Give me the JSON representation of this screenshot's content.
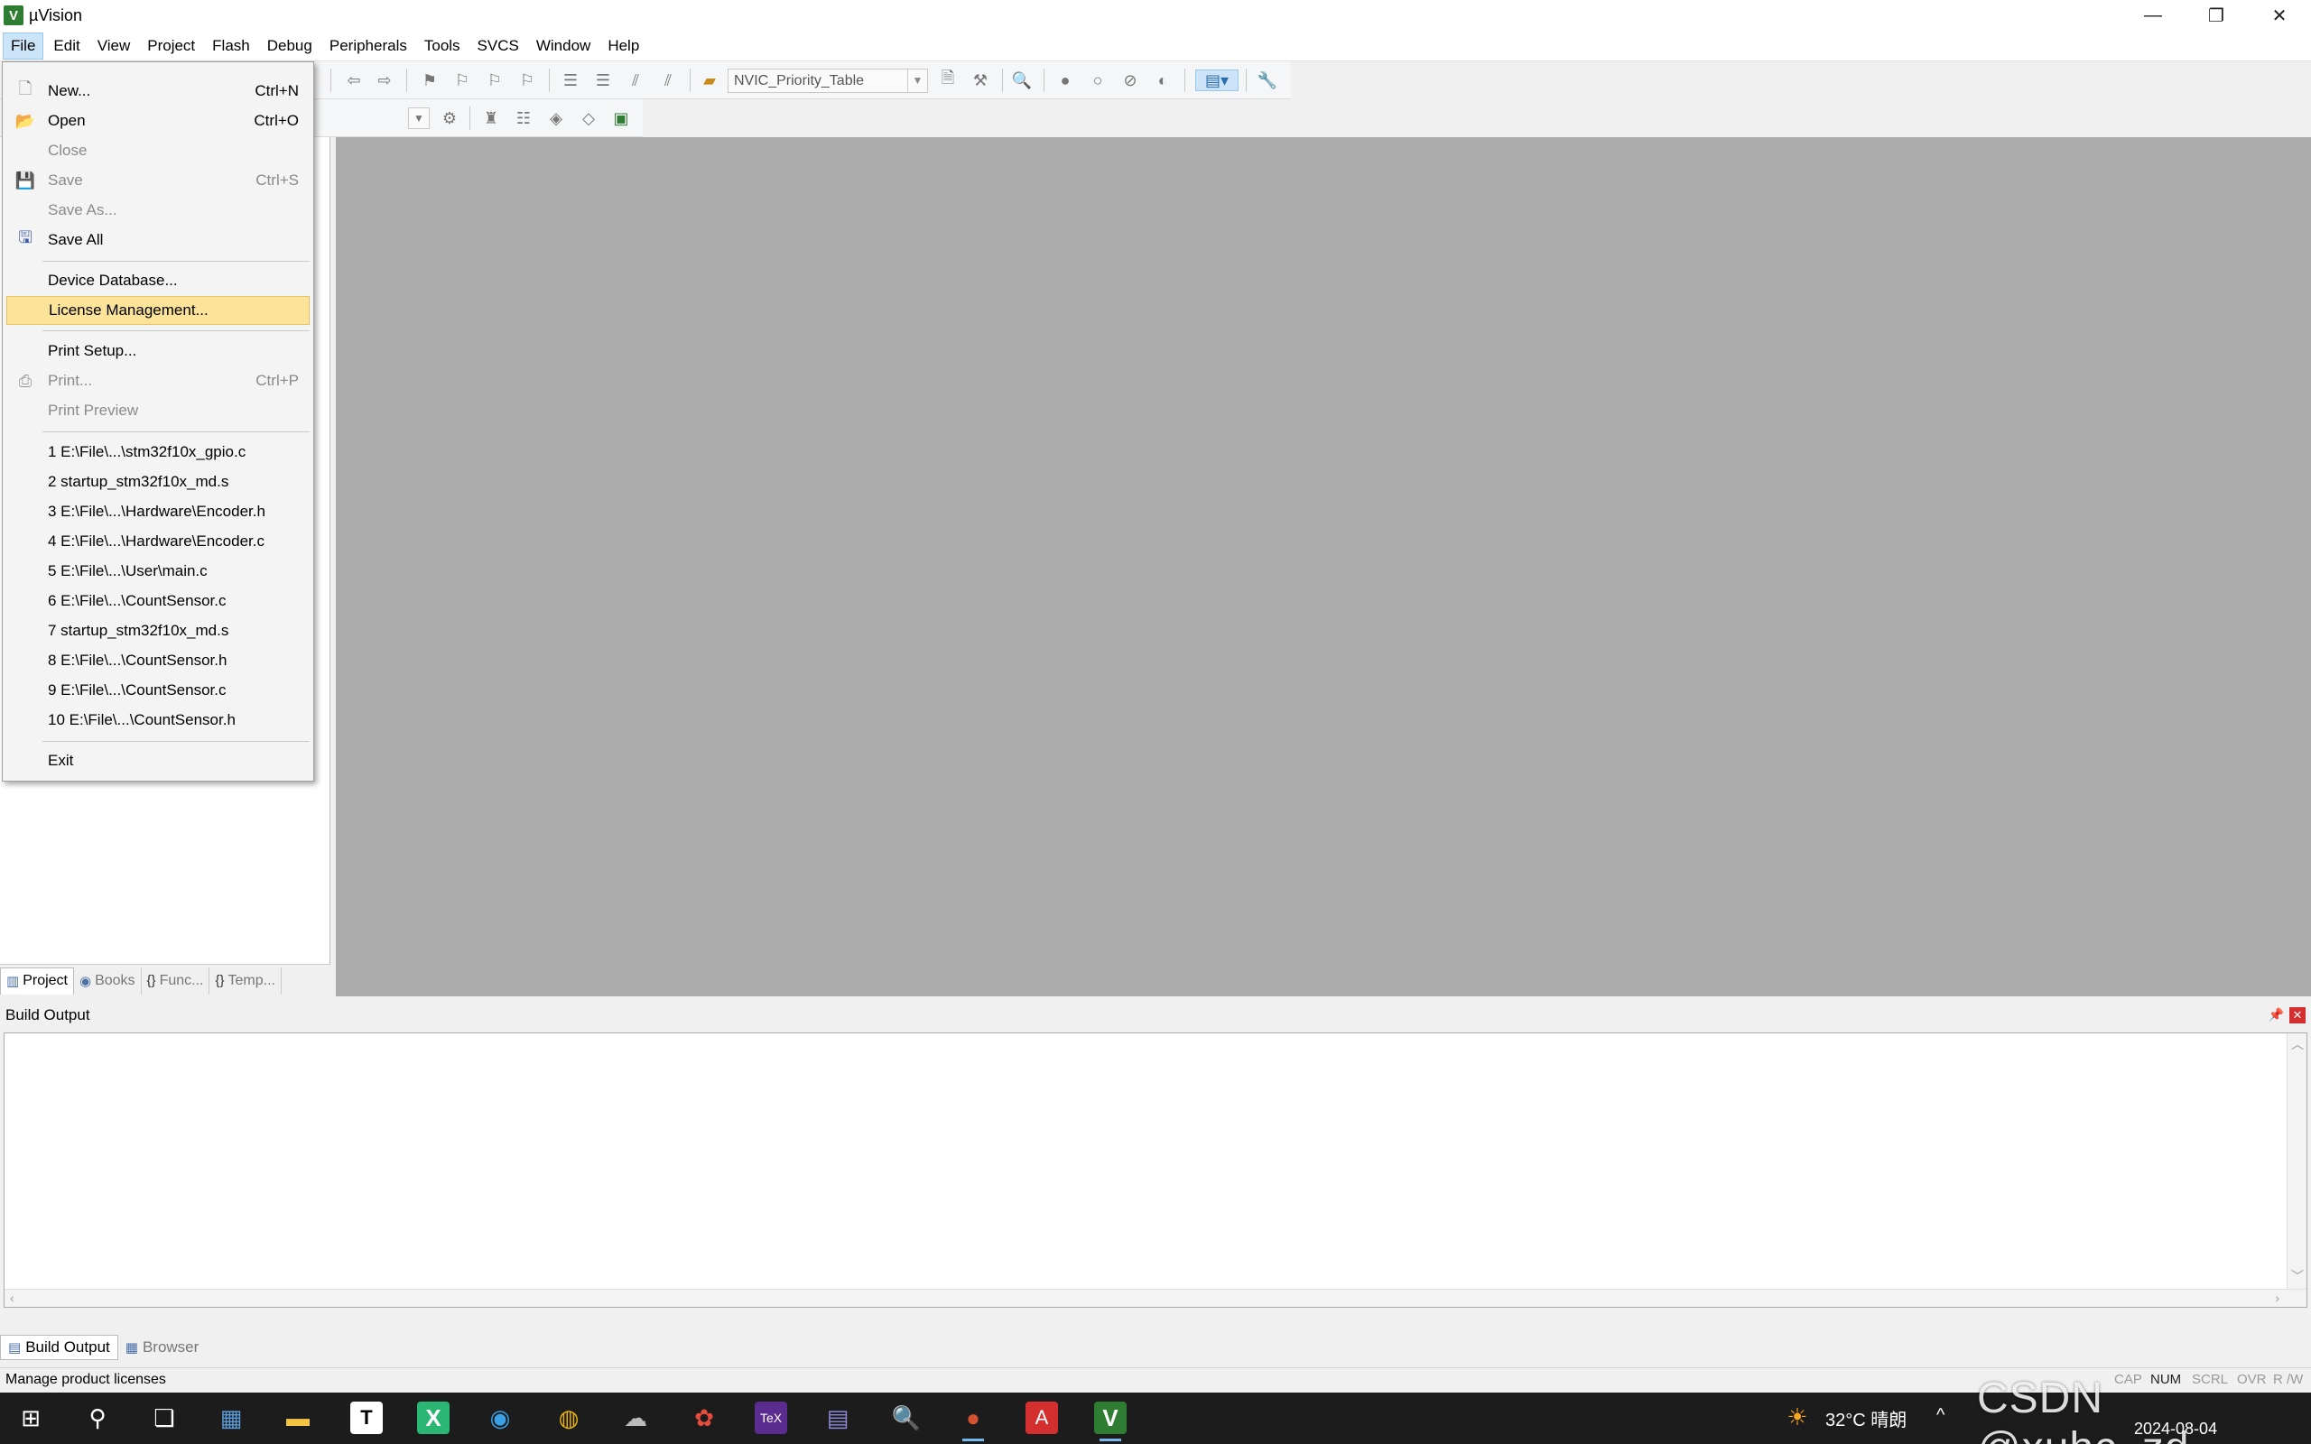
{
  "window": {
    "title": "µVision",
    "logo_letter": "V"
  },
  "menubar": [
    "File",
    "Edit",
    "View",
    "Project",
    "Flash",
    "Debug",
    "Peripherals",
    "Tools",
    "SVCS",
    "Window",
    "Help"
  ],
  "toolbar": {
    "target": "NVIC_Priority_Table"
  },
  "file_menu": {
    "new": {
      "label": "New...",
      "shortcut": "Ctrl+N"
    },
    "open": {
      "label": "Open",
      "shortcut": "Ctrl+O"
    },
    "close": {
      "label": "Close"
    },
    "save": {
      "label": "Save",
      "shortcut": "Ctrl+S"
    },
    "save_as": {
      "label": "Save As..."
    },
    "save_all": {
      "label": "Save All"
    },
    "device_db": {
      "label": "Device Database..."
    },
    "license": {
      "label": "License Management..."
    },
    "print_setup": {
      "label": "Print Setup..."
    },
    "print": {
      "label": "Print...",
      "shortcut": "Ctrl+P"
    },
    "print_preview": {
      "label": "Print Preview"
    },
    "recent": [
      "1 E:\\File\\...\\stm32f10x_gpio.c",
      "2 startup_stm32f10x_md.s",
      "3 E:\\File\\...\\Hardware\\Encoder.h",
      "4 E:\\File\\...\\Hardware\\Encoder.c",
      "5 E:\\File\\...\\User\\main.c",
      "6 E:\\File\\...\\CountSensor.c",
      "7 startup_stm32f10x_md.s",
      "8 E:\\File\\...\\CountSensor.h",
      "9 E:\\File\\...\\CountSensor.c",
      "10 E:\\File\\...\\CountSensor.h"
    ],
    "exit": {
      "label": "Exit"
    }
  },
  "panel_tabs": [
    "Project",
    "Books",
    "Func...",
    "Temp..."
  ],
  "build": {
    "title": "Build Output",
    "tabs": [
      "Build Output",
      "Browser"
    ]
  },
  "status": {
    "message": "Manage product licenses",
    "indicators": [
      "CAP",
      "NUM",
      "SCRL",
      "OVR",
      "R /W"
    ]
  },
  "taskbar": {
    "weather": "32°C 晴朗",
    "tray": "^",
    "date": "2024-08-04",
    "watermark": "CSDN @xuhc_zd"
  },
  "colors": {
    "highlight": "#fbe39a",
    "editor_bg": "#ababab",
    "taskbar": "#1c1c1c"
  }
}
